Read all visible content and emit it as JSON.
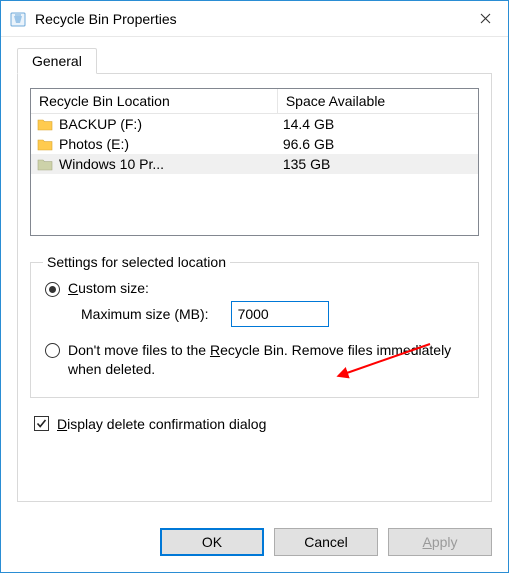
{
  "window": {
    "title": "Recycle Bin Properties"
  },
  "tabs": {
    "general": "General"
  },
  "list": {
    "header_location": "Recycle Bin Location",
    "header_space": "Space Available",
    "rows": [
      {
        "name": "BACKUP (F:)",
        "space": "14.4 GB",
        "folder_color": "#ffcb4f"
      },
      {
        "name": "Photos (E:)",
        "space": "96.6 GB",
        "folder_color": "#ffcb4f"
      },
      {
        "name": "Windows 10 Pr...",
        "space": "135 GB",
        "folder_color": "#cdd2a9"
      }
    ]
  },
  "settings": {
    "legend": "Settings for selected location",
    "custom_size_label": "Custom size:",
    "max_size_label": "Maximum size (MB):",
    "max_size_value": "7000",
    "dont_move_label": "Don't move files to the Recycle Bin. Remove files immediately when deleted."
  },
  "confirm": {
    "label": "Display delete confirmation dialog"
  },
  "buttons": {
    "ok": "OK",
    "cancel": "Cancel",
    "apply": "Apply"
  }
}
